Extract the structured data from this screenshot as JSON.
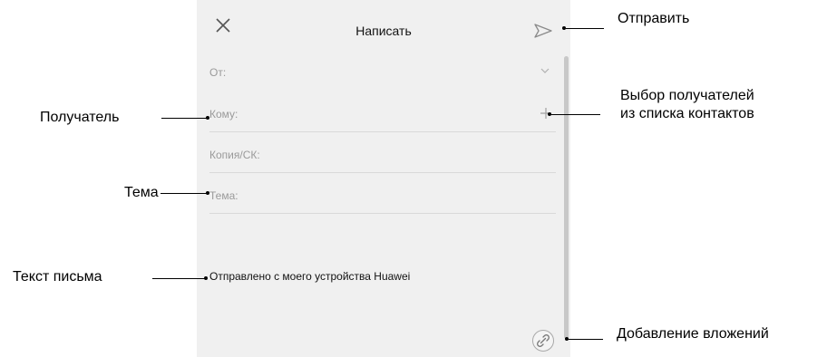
{
  "header": {
    "title": "Написать"
  },
  "fields": {
    "from_label": "От:",
    "to_label": "Кому:",
    "cc_label": "Копия/СК:",
    "subject_label": "Тема:"
  },
  "body": {
    "text": "Отправлено с моего устройства Huawei"
  },
  "icons": {
    "close": "close-icon",
    "send": "send-icon",
    "chevron": "chevron-down-icon",
    "add_recipient": "plus-icon",
    "attach": "paperclip-icon"
  },
  "callouts": {
    "send": "Отправить",
    "recipient": "Получатель",
    "choose_contacts_line1": "Выбор получателей",
    "choose_contacts_line2": "из списка контактов",
    "subject": "Тема",
    "body": "Текст письма",
    "attachments": "Добавление вложений"
  },
  "colors": {
    "screen_bg": "#f0f0f0",
    "label_gray": "#9a9a9a"
  }
}
